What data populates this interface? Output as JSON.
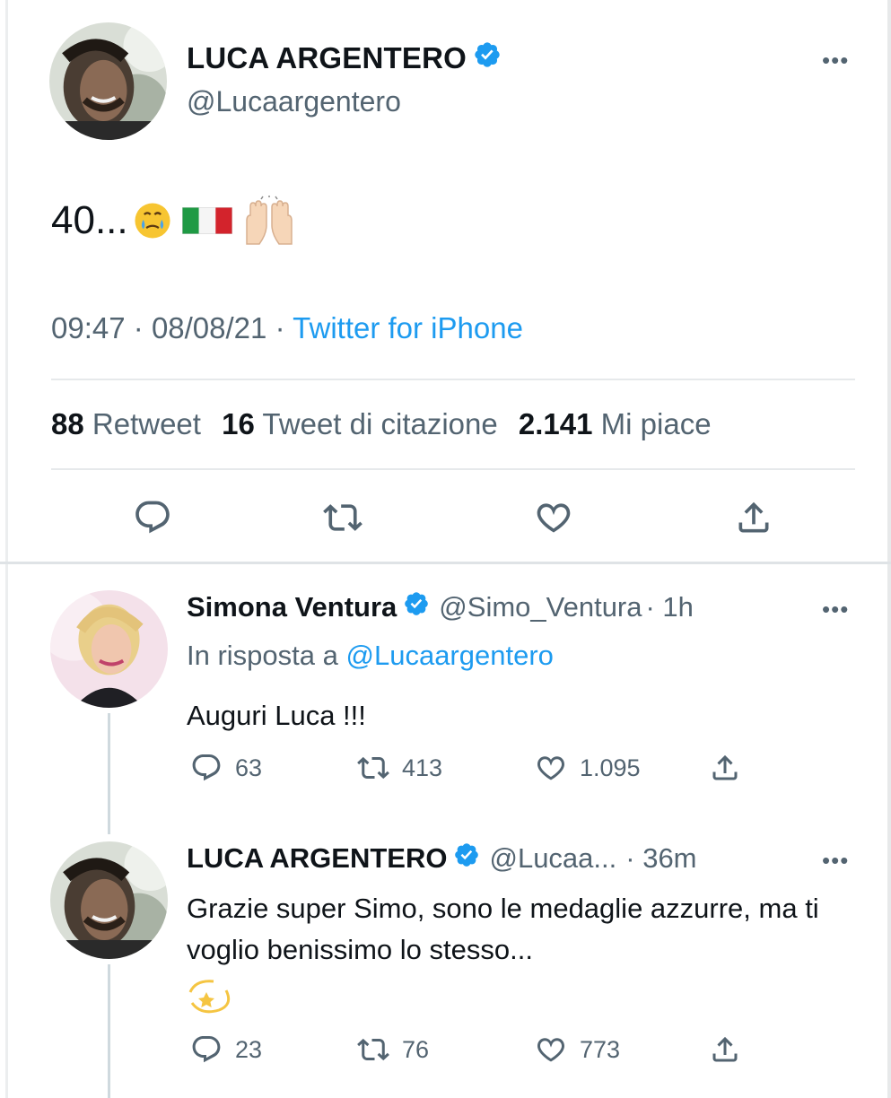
{
  "main_tweet": {
    "author_name": "LUCA ARGENTERO",
    "author_handle": "@Lucaargentero",
    "more_icon": "ellipsis-icon",
    "text": "40...",
    "emojis": [
      "face-holding-back-tears-icon",
      "italy-flag-icon",
      "raising-hands-icon"
    ],
    "time": "09:47",
    "date": "08/08/21",
    "separator": "·",
    "source": "Twitter for iPhone",
    "stats": {
      "retweets_count": "88",
      "retweets_label": "Retweet",
      "quotes_count": "16",
      "quotes_label": "Tweet di citazione",
      "likes_count": "2.141",
      "likes_label": "Mi piace"
    },
    "actions": [
      "reply-icon",
      "retweet-icon",
      "like-icon",
      "share-icon"
    ]
  },
  "replies": [
    {
      "author_name": "Simona Ventura",
      "author_handle": "@Simo_Ventura",
      "time": "· 1h",
      "reply_to_prefix": "In risposta a",
      "reply_to_handle": "@Lucaargentero",
      "text": "Auguri Luca !!!",
      "replies": "63",
      "retweets": "413",
      "likes": "1.095"
    },
    {
      "author_name": "LUCA ARGENTERO",
      "author_handle": "@Lucaa...",
      "time": "· 36m",
      "text": "Grazie super Simo, sono le medaglie azzurre, ma ti voglio benissimo lo stesso...",
      "emoji": "dizzy-star-icon",
      "replies": "23",
      "retweets": "76",
      "likes": "773"
    }
  ],
  "colors": {
    "link": "#1d9bf0",
    "secondary_text": "#536471",
    "primary_text": "#0f1419",
    "verified": "#1d9bf0"
  }
}
